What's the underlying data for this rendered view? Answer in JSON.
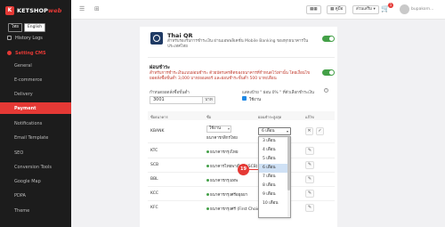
{
  "brand": {
    "name": "KETSHOP",
    "suffix": "web",
    "logo_letter": "K"
  },
  "languages": [
    {
      "label": "ไทย",
      "active": false
    },
    {
      "label": "English",
      "active": true
    }
  ],
  "sidebar": {
    "history": "History Logs",
    "section": "Setting CMS",
    "items": [
      {
        "label": "General"
      },
      {
        "label": "E-commerce"
      },
      {
        "label": "Delivery"
      },
      {
        "label": "Payment",
        "active": true
      },
      {
        "label": "Notifications"
      },
      {
        "label": "Email Template"
      },
      {
        "label": "SEO"
      },
      {
        "label": "Conversion Tools"
      },
      {
        "label": "Google Map"
      },
      {
        "label": "PDPA"
      },
      {
        "label": "Theme"
      }
    ]
  },
  "topbar": {
    "menu_icon": "☰",
    "grid_icon": "⊞",
    "btn1": "▦▦",
    "btn2": "▦ คู่มือ",
    "btn3": "ส่วนเสริม ▾",
    "cart_icon": "🛒",
    "cart_count": "1",
    "user_name": "bupakorn..."
  },
  "thai_qr": {
    "title": "Thai QR",
    "description": "สำหรับรองรับการชำระเงิน ผ่านแอพพลิเคชั่น Mobile Banking ของทุกธนาคารใน ประเทศไทย"
  },
  "installment": {
    "title": "ผ่อนชำระ",
    "desc1": "สำหรับการชำระเงินแบบผ่อนชำระ ด้วยบัตรเครดิตของธนาคารที่กำหนดไว้เท่านั้น โดยเงื่อนไข",
    "desc2": "ยอดสั่งซื้อขั้นต่ำ 3,000 บาท/ออเดอร์ และผ่อนชำระขั้นต่ำ 500 บาท/เดือน",
    "min_label": "กำหนดยอดสั่งซื้อขั้นต่ำ",
    "min_value": "3001",
    "min_unit": "บาท",
    "show_label": "แสดงป้าย \" ผ่อน 0% \" ที่ตัวเลือกชำระเงิน",
    "show_checkbox": "ใช้งาน"
  },
  "table": {
    "headers": [
      "ชื่อธนาคาร",
      "ชื่อ",
      "ผ่อนชำระสูงสุด",
      "แก้ไข"
    ],
    "rows": [
      {
        "code": "KBANK",
        "status": "ใช้งาน",
        "name": "ธนาคารกสิกรไทย"
      },
      {
        "code": "KTC",
        "name": "ธนาคารกรุงไทย"
      },
      {
        "code": "SCB",
        "name": "ธนาคารไทยพาณิชย์ (SCB)"
      },
      {
        "code": "BBL",
        "name": "ธนาคารกรุงเทพ"
      },
      {
        "code": "KCC",
        "name": "ธนาคารกรุงศรีอยุธยา"
      },
      {
        "code": "KFC",
        "name": "ธนาคารกรุงศรี (First Choice)"
      }
    ]
  },
  "dropdown": {
    "selected": "6 เดือน",
    "options": [
      "3 เดือน",
      "4 เดือน",
      "5 เดือน",
      "6 เดือน",
      "7 เดือน",
      "8 เดือน",
      "9 เดือน",
      "10 เดือน"
    ],
    "highlighted": "6 เดือน"
  },
  "step_badge": "19",
  "colors": {
    "accent": "#e53935",
    "toggle_on": "#43a047",
    "highlight": "#cfe1f5"
  },
  "icons": {
    "edit": "✎",
    "close": "✕",
    "check": "✓",
    "chevron": "▾",
    "info": "i"
  }
}
